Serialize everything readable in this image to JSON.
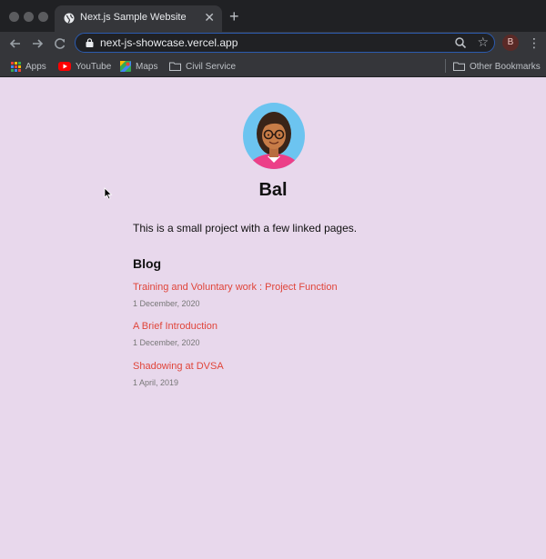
{
  "browser": {
    "tab_title": "Next.js Sample Website",
    "url": "next-js-showcase.vercel.app",
    "profile_initial": "B",
    "bookmarks": [
      {
        "label": "Apps",
        "icon": "apps-grid-icon"
      },
      {
        "label": "YouTube",
        "icon": "youtube-icon"
      },
      {
        "label": "Maps",
        "icon": "maps-icon"
      },
      {
        "label": "Civil Service",
        "icon": "folder-icon"
      }
    ],
    "other_bookmarks": "Other Bookmarks"
  },
  "page": {
    "name": "Bal",
    "intro": "This is a small project with a few linked pages.",
    "blog_heading": "Blog",
    "posts": [
      {
        "title": "Training and Voluntary work : Project Function",
        "date": "1 December, 2020"
      },
      {
        "title": "A Brief Introduction",
        "date": "1 December, 2020"
      },
      {
        "title": "Shadowing at DVSA",
        "date": "1 April, 2019"
      }
    ]
  },
  "colors": {
    "page_background": "#e8d8ec",
    "link": "#e0453a",
    "date": "#777777",
    "avatar_background": "#6cc4f0"
  }
}
